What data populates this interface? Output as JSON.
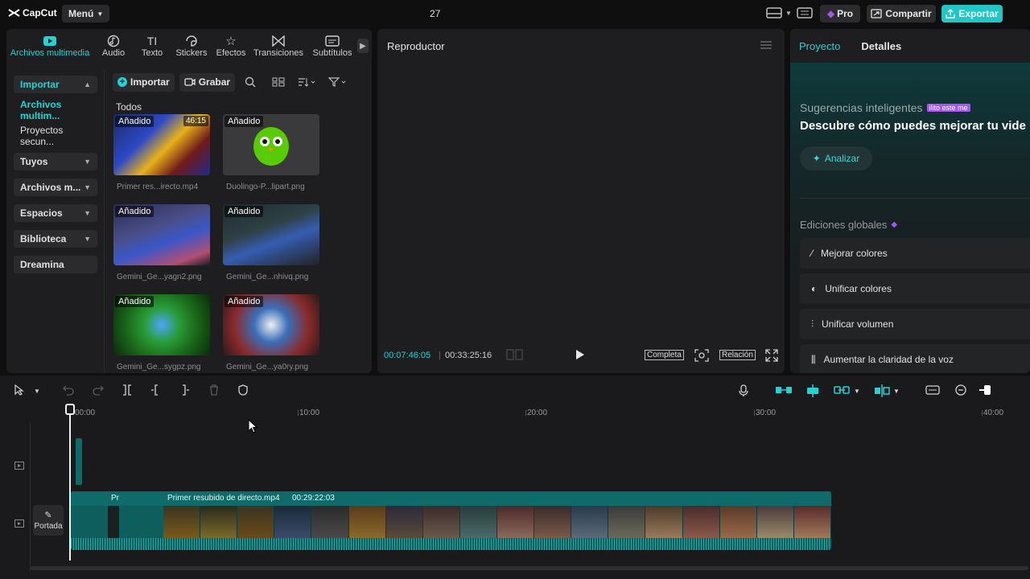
{
  "topbar": {
    "logo": "CapCut",
    "menu_label": "Menú",
    "project_name": "27",
    "pro_label": "Pro",
    "share_label": "Compartir",
    "export_label": "Exportar"
  },
  "media": {
    "tabs": [
      {
        "label": "Archivos multimedia",
        "icon": "media-icon"
      },
      {
        "label": "Audio",
        "icon": "audio-icon"
      },
      {
        "label": "Texto",
        "icon": "text-icon"
      },
      {
        "label": "Stickers",
        "icon": "sticker-icon"
      },
      {
        "label": "Efectos",
        "icon": "effects-icon"
      },
      {
        "label": "Transiciones",
        "icon": "transitions-icon"
      },
      {
        "label": "Subtítulos",
        "icon": "subtitles-icon"
      }
    ],
    "sidebar": [
      {
        "label": "Importar"
      },
      {
        "label": "Archivos multim..."
      },
      {
        "label": "Proyectos secun..."
      },
      {
        "label": "Tuyos"
      },
      {
        "label": "Archivos m..."
      },
      {
        "label": "Espacios"
      },
      {
        "label": "Biblioteca"
      },
      {
        "label": "Dreamina"
      }
    ],
    "import_label": "Importar",
    "record_label": "Grabar",
    "section_label": "Todos",
    "added_tag": "Añadido",
    "items": [
      {
        "name": "Primer res...irecto.mp4",
        "duration": "46:15"
      },
      {
        "name": "Duolingo-P...lipart.png"
      },
      {
        "name": "Gemini_Ge...yagn2.png"
      },
      {
        "name": "Gemini_Ge...nhivq.png"
      },
      {
        "name": "Gemini_Ge...sygpz.png"
      },
      {
        "name": "Gemini_Ge...ya0ry.png"
      }
    ]
  },
  "player": {
    "title": "Reproductor",
    "current_time": "00:07:46:05",
    "total_time": "00:33:25:16",
    "full_label": "Completa",
    "ratio_label": "Relación"
  },
  "right": {
    "tabs": [
      "Proyecto",
      "Detalles"
    ],
    "suggest_title": "Sugerencias inteligentes",
    "suggest_badge": "ilito este me",
    "suggest_desc": "Descubre cómo puedes mejorar tu vide",
    "analyze_label": "Analizar",
    "global_title": "Ediciones globales",
    "global_items": [
      {
        "label": "Mejorar colores"
      },
      {
        "label": "Unificar colores"
      },
      {
        "label": "Unificar volumen"
      },
      {
        "label": "Aumentar la claridad de la voz"
      }
    ]
  },
  "timeline": {
    "ruler_labels": [
      "00:00",
      "10:00",
      "20:00",
      "30:00",
      "40:00"
    ],
    "portada_label": "Portada",
    "clip_short": "Pr",
    "clip_title": "Primer resubido de directo.mp4",
    "clip_duration": "00:29:22:03"
  },
  "colors": {
    "accent": "#22d3d3",
    "export": "#1fc7c7",
    "clip": "#0d5e5c",
    "pro": "#a855f7"
  }
}
